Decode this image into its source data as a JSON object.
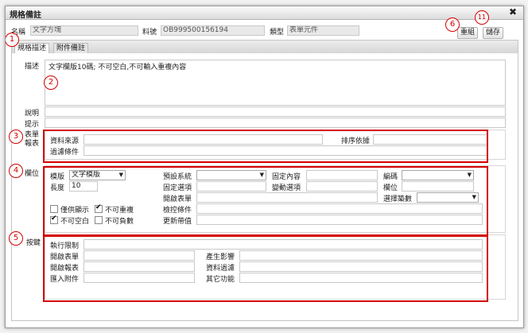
{
  "dialog": {
    "title": "規格備註",
    "close_icon": "✖"
  },
  "header": {
    "name_label": "名稱",
    "name_value": "文字方塊",
    "code_label": "料號",
    "code_value": "OB999500156194",
    "type_label": "類型",
    "type_value": "表單元件",
    "reset_button": "重組",
    "save_button": "儲存"
  },
  "tabs": [
    {
      "label": "規格描述"
    },
    {
      "label": "附件備註"
    }
  ],
  "main": {
    "description_label": "描述",
    "description_value": "文字欄版10碼; 不可空白,不可輸入重複內容",
    "explain_label": "說明",
    "hint_label": "提示"
  },
  "form_table": {
    "label_line1": "表單",
    "label_line2": "報表",
    "data_source": "資料來源",
    "sort_by": "排序依據",
    "filter": "過濾條件"
  },
  "field": {
    "section_label": "欄位",
    "template_label": "模版",
    "template_value": "文字模版",
    "length_label": "長度",
    "length_value": "10",
    "display_only": "僅供顯示",
    "no_duplicate": "不可重複",
    "not_empty": "不可空白",
    "no_negative": "不可負數",
    "preset_system": "預設系統",
    "fixed_item": "固定選項",
    "open_form": "開啟表單",
    "check_condition": "檢控條件",
    "update_value": "更新帶值",
    "fixed_content": "固定內容",
    "linked_item": "變動選項",
    "encoding": "編碼",
    "field_pos": "欄位",
    "select_digits": "選擇築數"
  },
  "buttons_section": {
    "section_label": "按鍵",
    "exec_limit": "執行限制",
    "open_form": "開啟表單",
    "open_report": "開啟報表",
    "import_attachment": "匯入附件",
    "impact": "產生影響",
    "data_filter": "資料過濾",
    "other_function": "其它功能"
  },
  "annotations": {
    "m1": "1",
    "m2": "2",
    "m3": "3",
    "m4": "4",
    "m5": "5",
    "m6": "6",
    "m11": "11"
  },
  "colors": {
    "annotation_red": "#d40000"
  }
}
